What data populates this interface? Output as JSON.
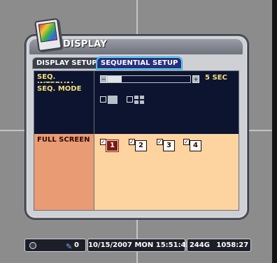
{
  "window": {
    "title": "DISPLAY",
    "icon": "monitor-icon"
  },
  "tabs": [
    {
      "label": "DISPLAY SETUP",
      "active": false
    },
    {
      "label": "SEQUENTIAL SETUP",
      "active": true
    }
  ],
  "settings": {
    "seq_interval": {
      "label": "SEQ. INTERVAL",
      "value": "5 SEC",
      "slider_fraction": 0.17,
      "minus": "−",
      "plus": "+"
    },
    "seq_mode": {
      "label": "SEQ. MODE",
      "options": [
        "single-view-icon",
        "quad-view-icon"
      ]
    },
    "full_screen": {
      "label": "FULL SCREEN",
      "cameras": [
        {
          "num": "1",
          "checked": true,
          "selected": true
        },
        {
          "num": "2",
          "checked": true,
          "selected": false
        },
        {
          "num": "3",
          "checked": true,
          "selected": false
        },
        {
          "num": "4",
          "checked": true,
          "selected": false
        }
      ],
      "check_mark": "✓"
    }
  },
  "status_bar": {
    "count": "0",
    "datetime": "10/15/2007 MON 15:51:45",
    "storage": "244G",
    "time": "1058:27"
  },
  "colors": {
    "panel_bg": "#0d1430",
    "label_text": "#f4e07a",
    "full_screen_bg": "#fdd3a0",
    "full_screen_label_bg": "#e99b74",
    "selected_camera": "#7a1b12"
  }
}
